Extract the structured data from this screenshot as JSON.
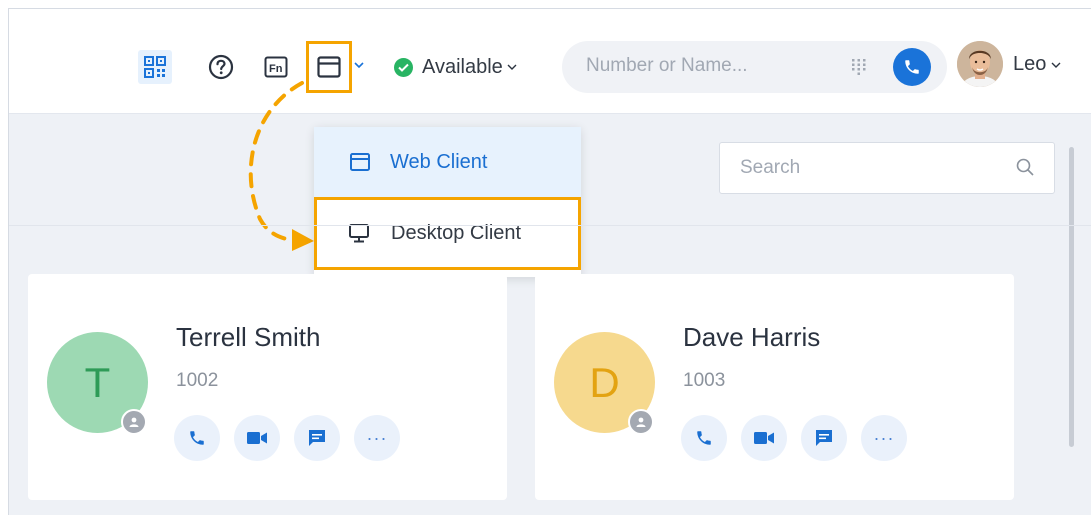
{
  "topbar": {
    "icons": [
      "qr-code-icon",
      "help-icon",
      "fn-keys-icon",
      "client-window-icon",
      "chevron-down-icon"
    ],
    "status_label": "Available",
    "status_color": "#28b463",
    "search_placeholder": "Number or Name...",
    "user_name": "Leo",
    "accent": "#1a73d9",
    "highlight": "#f5a400"
  },
  "client_menu": {
    "items": [
      {
        "label": "Web Client",
        "icon": "browser-window-icon",
        "selected": true
      },
      {
        "label": "Desktop Client",
        "icon": "monitor-icon",
        "selected": false
      }
    ]
  },
  "contacts": {
    "search_placeholder": "Search",
    "cards": [
      {
        "initial": "T",
        "name": "Terrell Smith",
        "extension": "1002",
        "avatar_color": "#9dd9b3",
        "initial_color": "#2e9b57"
      },
      {
        "initial": "D",
        "name": "Dave Harris",
        "extension": "1003",
        "avatar_color": "#f6d98e",
        "initial_color": "#e3a312"
      }
    ]
  }
}
